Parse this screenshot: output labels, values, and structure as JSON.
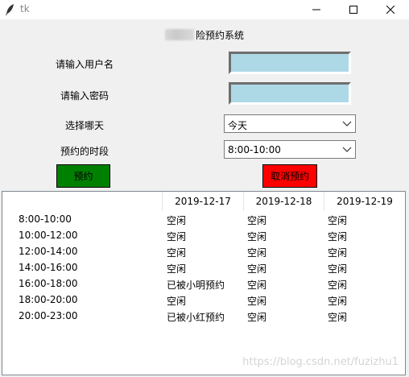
{
  "window": {
    "title": "tk",
    "minimize_glyph": "—",
    "maximize_glyph": "☐",
    "close_glyph": "✕"
  },
  "header": {
    "title_visible": "险预约系统"
  },
  "form": {
    "username_label": "请输入用户名",
    "username_value": "",
    "password_label": "请输入密码",
    "password_value": "",
    "day_label": "选择哪天",
    "day_selected": "今天",
    "slot_label": "预约的时段",
    "slot_selected": "8:00-10:00"
  },
  "buttons": {
    "book_label": "预约",
    "cancel_label": "取消预约"
  },
  "colors": {
    "entry_bg": "#add8e6",
    "book_bg": "#008000",
    "cancel_bg": "#ff0000"
  },
  "table": {
    "columns": [
      "",
      "2019-12-17",
      "2019-12-18",
      "2019-12-19"
    ],
    "rows": [
      {
        "slot": "8:00-10:00",
        "d1": "空闲",
        "d2": "空闲",
        "d3": "空闲"
      },
      {
        "slot": "10:00-12:00",
        "d1": "空闲",
        "d2": "空闲",
        "d3": "空闲"
      },
      {
        "slot": "12:00-14:00",
        "d1": "空闲",
        "d2": "空闲",
        "d3": "空闲"
      },
      {
        "slot": "14:00-16:00",
        "d1": "空闲",
        "d2": "空闲",
        "d3": "空闲"
      },
      {
        "slot": "16:00-18:00",
        "d1": "已被小明预约",
        "d2": "空闲",
        "d3": "空闲"
      },
      {
        "slot": "18:00-20:00",
        "d1": "空闲",
        "d2": "空闲",
        "d3": "空闲"
      },
      {
        "slot": "20:00-23:00",
        "d1": "已被小红预约",
        "d2": "空闲",
        "d3": "空闲"
      }
    ]
  },
  "watermark": "https://blog.csdn.net/fuzizhu1"
}
